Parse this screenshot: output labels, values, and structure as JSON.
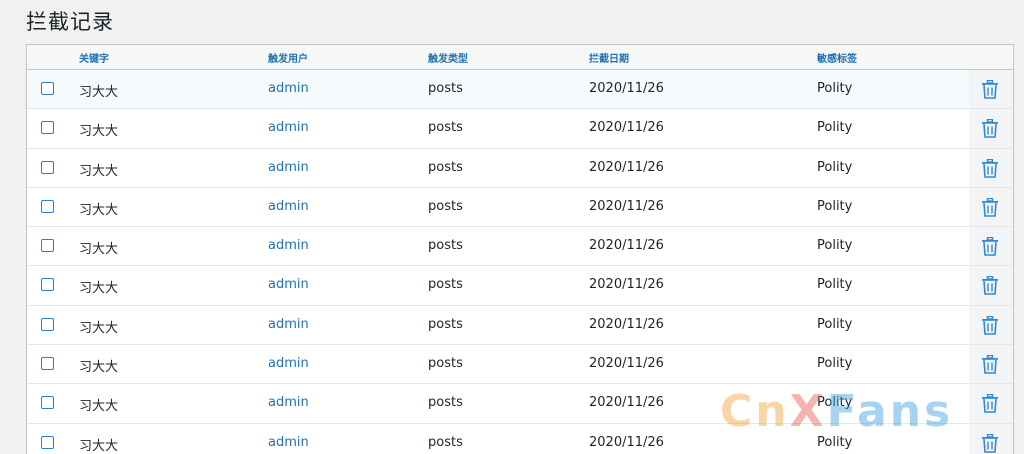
{
  "page": {
    "title": "拦截记录"
  },
  "table": {
    "headers": {
      "keyword": "关键字",
      "user": "触发用户",
      "type": "触发类型",
      "date": "拦截日期",
      "tag": "敏感标签"
    },
    "rows": [
      {
        "keyword": "习大大",
        "user": "admin",
        "type": "posts",
        "date": "2020/11/26",
        "tag": "Polity"
      },
      {
        "keyword": "习大大",
        "user": "admin",
        "type": "posts",
        "date": "2020/11/26",
        "tag": "Polity"
      },
      {
        "keyword": "习大大",
        "user": "admin",
        "type": "posts",
        "date": "2020/11/26",
        "tag": "Polity"
      },
      {
        "keyword": "习大大",
        "user": "admin",
        "type": "posts",
        "date": "2020/11/26",
        "tag": "Polity"
      },
      {
        "keyword": "习大大",
        "user": "admin",
        "type": "posts",
        "date": "2020/11/26",
        "tag": "Polity"
      },
      {
        "keyword": "习大大",
        "user": "admin",
        "type": "posts",
        "date": "2020/11/26",
        "tag": "Polity"
      },
      {
        "keyword": "习大大",
        "user": "admin",
        "type": "posts",
        "date": "2020/11/26",
        "tag": "Polity"
      },
      {
        "keyword": "习大大",
        "user": "admin",
        "type": "posts",
        "date": "2020/11/26",
        "tag": "Polity"
      },
      {
        "keyword": "习大大",
        "user": "admin",
        "type": "posts",
        "date": "2020/11/26",
        "tag": "Polity"
      },
      {
        "keyword": "习大大",
        "user": "admin",
        "type": "posts",
        "date": "2020/11/26",
        "tag": "Polity"
      }
    ]
  },
  "watermark": {
    "part1": "Cn",
    "part2": "X",
    "part3": "Fans"
  },
  "icons": {
    "row_action": "trash-icon",
    "row_select": "checkbox"
  },
  "colors": {
    "accent": "#2271b1",
    "checkbox": "#2e7bd1"
  }
}
